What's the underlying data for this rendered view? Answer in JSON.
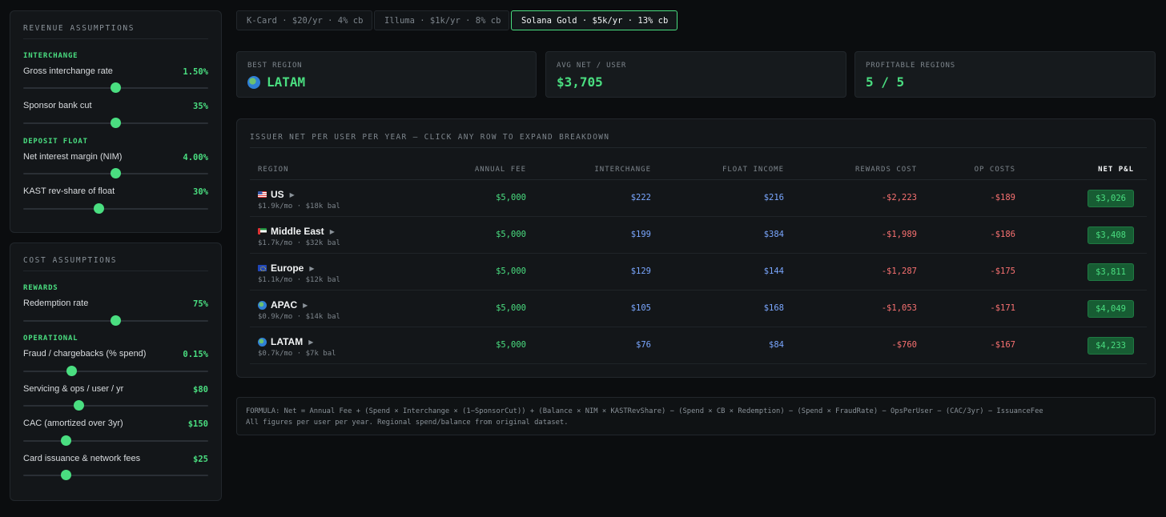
{
  "colors": {
    "background": "#0b0d0f",
    "panel": "#131619",
    "accent_green": "#4ade80",
    "positive_blue": "#7aa7ff",
    "negative_red": "#f87171",
    "net_pill": "#175c33"
  },
  "revenue_panel": {
    "title": "REVENUE ASSUMPTIONS",
    "groups": [
      {
        "label": "INTERCHANGE",
        "sliders": [
          {
            "label": "Gross interchange rate",
            "value": "1.50%",
            "level": 0.5
          },
          {
            "label": "Sponsor bank cut",
            "value": "35%",
            "level": 0.5
          }
        ]
      },
      {
        "label": "DEPOSIT FLOAT",
        "sliders": [
          {
            "label": "Net interest margin (NIM)",
            "value": "4.00%",
            "level": 0.5
          },
          {
            "label": "KAST rev-share of float",
            "value": "30%",
            "level": 0.41
          }
        ]
      }
    ]
  },
  "cost_panel": {
    "title": "COST ASSUMPTIONS",
    "groups": [
      {
        "label": "REWARDS",
        "sliders": [
          {
            "label": "Redemption rate",
            "value": "75%",
            "level": 0.5
          }
        ]
      },
      {
        "label": "OPERATIONAL",
        "sliders": [
          {
            "label": "Fraud / chargebacks (% spend)",
            "value": "0.15%",
            "level": 0.26
          },
          {
            "label": "Servicing & ops / user / yr",
            "value": "$80",
            "level": 0.3
          },
          {
            "label": "CAC (amortized over 3yr)",
            "value": "$150",
            "level": 0.23
          },
          {
            "label": "Card issuance & network fees",
            "value": "$25",
            "level": 0.23
          }
        ]
      }
    ]
  },
  "card_tabs": [
    {
      "label": "K-Card · $20/yr · 4% cb",
      "active": false
    },
    {
      "label": "Illuma · $1k/yr · 8% cb",
      "active": false
    },
    {
      "label": "Solana Gold · $5k/yr · 13% cb",
      "active": true
    }
  ],
  "stats": [
    {
      "label": "BEST REGION",
      "value": "LATAM",
      "icon": "globe-americas-icon"
    },
    {
      "label": "AVG NET / USER",
      "value": "$3,705"
    },
    {
      "label": "PROFITABLE REGIONS",
      "value": "5 / 5"
    }
  ],
  "table": {
    "title": "ISSUER NET PER USER PER YEAR — CLICK ANY ROW TO EXPAND BREAKDOWN",
    "headers": {
      "region": "REGION",
      "annual_fee": "ANNUAL FEE",
      "interchange": "INTERCHANGE",
      "float_income": "FLOAT INCOME",
      "rewards_cost": "REWARDS COST",
      "op_costs": "OP COSTS",
      "net_pl": "NET P&L"
    },
    "rows": [
      {
        "flag": "us-flag-icon",
        "name": "US",
        "sub": "$1.9k/mo · $18k bal",
        "annual_fee": "$5,000",
        "interchange": "$222",
        "float_income": "$216",
        "rewards_cost": "-$2,223",
        "op_costs": "-$189",
        "net": "$3,026"
      },
      {
        "flag": "uae-flag-icon",
        "name": "Middle East",
        "sub": "$1.7k/mo · $32k bal",
        "annual_fee": "$5,000",
        "interchange": "$199",
        "float_income": "$384",
        "rewards_cost": "-$1,989",
        "op_costs": "-$186",
        "net": "$3,408"
      },
      {
        "flag": "eu-flag-icon",
        "name": "Europe",
        "sub": "$1.1k/mo · $12k bal",
        "annual_fee": "$5,000",
        "interchange": "$129",
        "float_income": "$144",
        "rewards_cost": "-$1,287",
        "op_costs": "-$175",
        "net": "$3,811"
      },
      {
        "flag": "globe-asia-icon",
        "name": "APAC",
        "sub": "$0.9k/mo · $14k bal",
        "annual_fee": "$5,000",
        "interchange": "$105",
        "float_income": "$168",
        "rewards_cost": "-$1,053",
        "op_costs": "-$171",
        "net": "$4,049"
      },
      {
        "flag": "globe-americas-icon",
        "name": "LATAM",
        "sub": "$0.7k/mo · $7k bal",
        "annual_fee": "$5,000",
        "interchange": "$76",
        "float_income": "$84",
        "rewards_cost": "-$760",
        "op_costs": "-$167",
        "net": "$4,233"
      }
    ]
  },
  "formula": {
    "line1": "FORMULA: Net = Annual Fee + (Spend × Interchange × (1−SponsorCut)) + (Balance × NIM × KASTRevShare) − (Spend × CB × Redemption) − (Spend × FraudRate) − OpsPerUser − (CAC/3yr) − IssuanceFee",
    "line2": "All figures per user per year. Regional spend/balance from original dataset."
  }
}
